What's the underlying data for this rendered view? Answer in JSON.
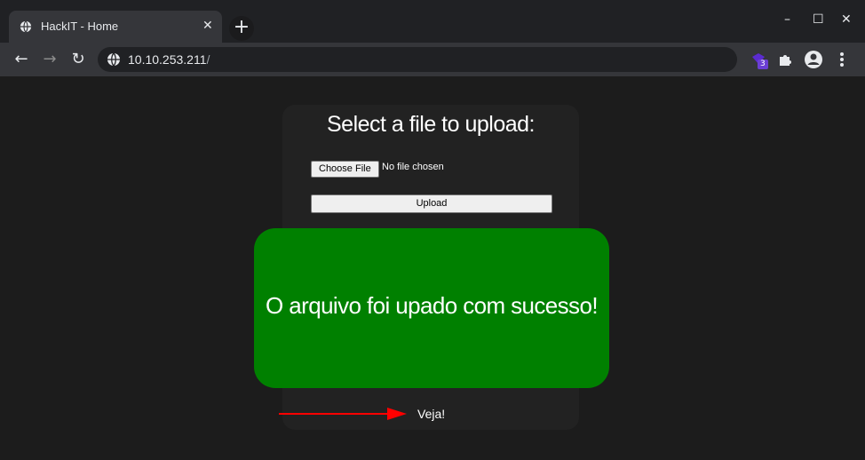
{
  "tab": {
    "title": "HackIT - Home",
    "close": "✕",
    "favicon": "globe-icon"
  },
  "new_tab_label": "+",
  "window_controls": {
    "minimize": "–",
    "maximize": "☐",
    "close": "✕"
  },
  "toolbar": {
    "back": "←",
    "forward": "→",
    "reload": "↻",
    "url_host": "10.10.253.211",
    "url_path": "/",
    "extension_badge": "3"
  },
  "page": {
    "heading": "Select a file to upload:",
    "choose_file_label": "Choose File",
    "no_file_text": "No file chosen",
    "upload_label": "Upload",
    "success_message": "O arquivo foi upado com sucesso!",
    "success_color": "#008000",
    "veja_text": "Veja!",
    "arrow_color": "#ff0000"
  }
}
